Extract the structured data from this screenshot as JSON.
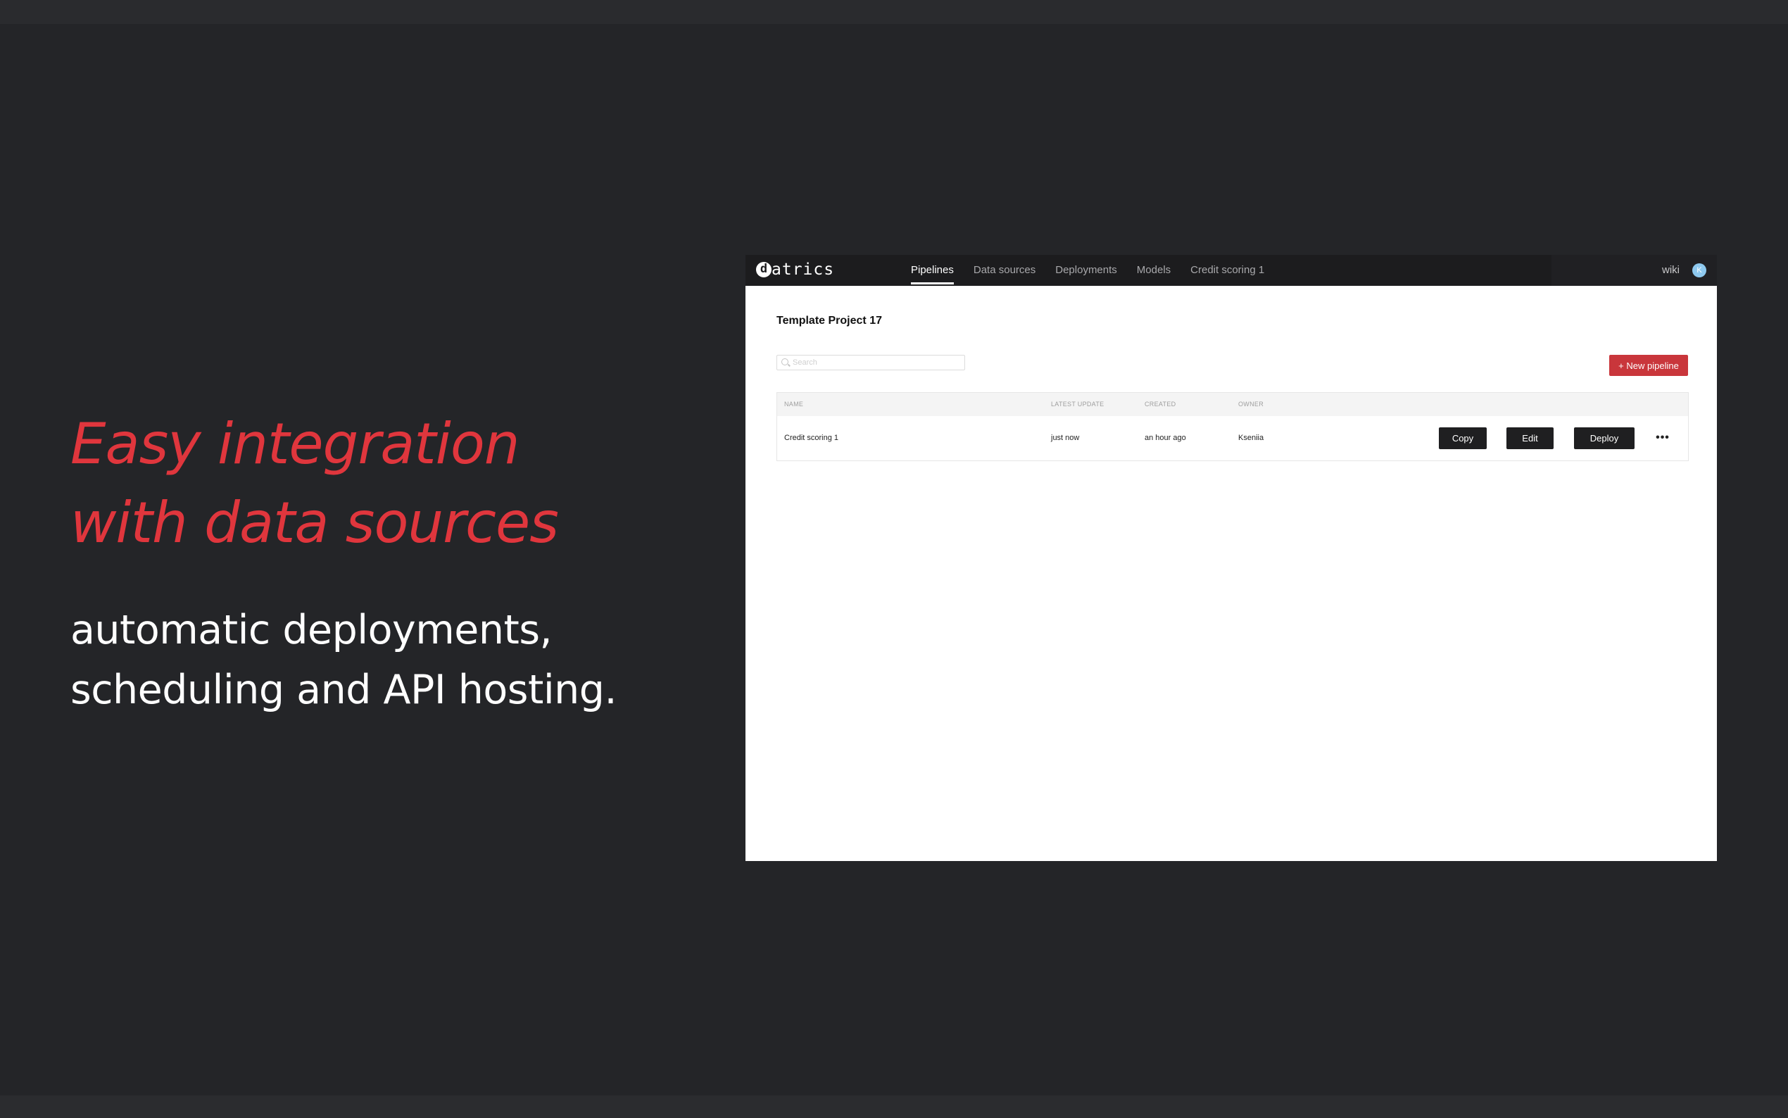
{
  "marketing": {
    "headline_lines": [
      "Easy integration",
      "with data sources"
    ],
    "subline_lines": [
      "automatic deployments,",
      "scheduling and API hosting."
    ],
    "accent_color": "#e0363d"
  },
  "app": {
    "logo": {
      "mark": "d",
      "text": "atrics"
    },
    "nav": {
      "items": [
        "Pipelines",
        "Data sources",
        "Deployments",
        "Models",
        "Credit scoring 1"
      ],
      "active": "Pipelines"
    },
    "header_right": {
      "wiki_label": "wiki",
      "avatar_initial": "K",
      "avatar_color": "#8ec9ef"
    },
    "project_title": "Template Project 17",
    "search": {
      "placeholder": "Search",
      "icon": "search-icon"
    },
    "new_pipeline_label": "+ New pipeline",
    "table": {
      "columns": [
        "NAME",
        "LATEST UPDATE",
        "CREATED",
        "OWNER"
      ],
      "rows": [
        {
          "name": "Credit scoring 1",
          "latest_update": "just now",
          "created": "an hour ago",
          "owner": "Kseniia",
          "actions": [
            "Copy",
            "Edit",
            "Deploy"
          ],
          "more_icon": "more-horizontal-icon"
        }
      ]
    },
    "primary_button_color": "#c9363b"
  }
}
